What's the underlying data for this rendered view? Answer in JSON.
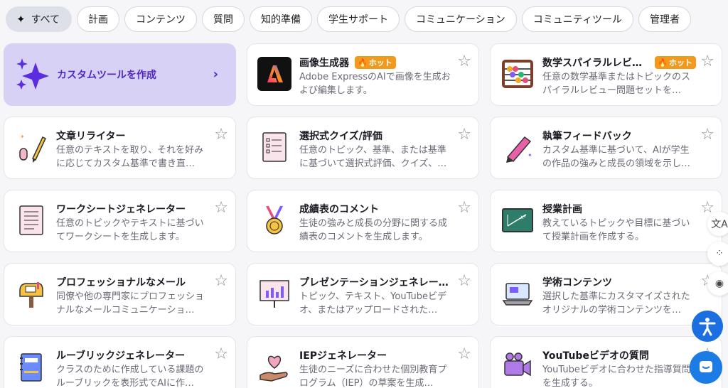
{
  "filters": [
    {
      "label": "すべて",
      "active": true
    },
    {
      "label": "計画"
    },
    {
      "label": "コンテンツ"
    },
    {
      "label": "質問"
    },
    {
      "label": "知的準備"
    },
    {
      "label": "学生サポート"
    },
    {
      "label": "コミュニケーション"
    },
    {
      "label": "コミュニティツール"
    },
    {
      "label": "管理者"
    }
  ],
  "custom_tool": {
    "label": "カスタムツールを作成",
    "icon": "sparkles-icon"
  },
  "hot_label": "ホット",
  "tools": [
    {
      "title": "画像生成器",
      "hot": true,
      "desc": "Adobe ExpressのAIで画像を生成および編集します。",
      "icon": "adobe-express-icon"
    },
    {
      "title": "数学スパイラルレビュ…",
      "hot": true,
      "desc": "任意の数学基準またはトピックのスパイラルレビュー問題セットを…",
      "icon": "abacus-icon"
    },
    {
      "title": "文章リライター",
      "desc": "任意のテキストを取り、それを好みに応じてカスタム基準で書き直…",
      "icon": "pencil-icon"
    },
    {
      "title": "選択式クイズ/評価",
      "desc": "任意のトピック、基準、または基準に基づいて選択式評価、クイズ、…",
      "icon": "quiz-sheet-icon"
    },
    {
      "title": "執筆フィードバック",
      "desc": "カスタム基準に基づいて、AIが学生の作品の強みと成長の領域を示し…",
      "icon": "pen-icon"
    },
    {
      "title": "ワークシートジェネレーター",
      "desc": "任意のトピックやテキストに基づいてワークシートを生成します。",
      "icon": "worksheet-icon"
    },
    {
      "title": "成績表のコメント",
      "desc": "生徒の強みと成長の分野に関する成績表のコメントを生成します。",
      "icon": "medal-icon"
    },
    {
      "title": "授業計画",
      "desc": "教えているトピックや目標に基づいて授業計画を作成する。",
      "icon": "chalkboard-icon"
    },
    {
      "title": "プロフェッショナルなメール",
      "desc": "同僚や他の専門家にプロフェッショナルなメールコミュニケーショ…",
      "icon": "mailbox-icon"
    },
    {
      "title": "プレゼンテーションジェネレータ…",
      "desc": "トピック、テキスト、YouTubeビデオ、またはアップロードされた…",
      "icon": "presentation-icon"
    },
    {
      "title": "学術コンテンツ",
      "desc": "選択した基準にカスタマイズされたオリジナルの学術コンテンツを…",
      "icon": "laptop-icon"
    },
    {
      "title": "ルーブリックジェネレーター",
      "desc": "クラスのために作成している課題のルーブリックを表形式でAIに作…",
      "icon": "notebook-icon"
    },
    {
      "title": "IEPジェネレーター",
      "desc": "生徒のニーズに合わせた個別教育プログラム（IEP）の草案を生成…",
      "icon": "heart-hand-icon"
    },
    {
      "title": "YouTubeビデオの質問",
      "desc": "YouTubeビデオに合わせた指導質問を生成する。",
      "icon": "video-camera-icon"
    }
  ]
}
